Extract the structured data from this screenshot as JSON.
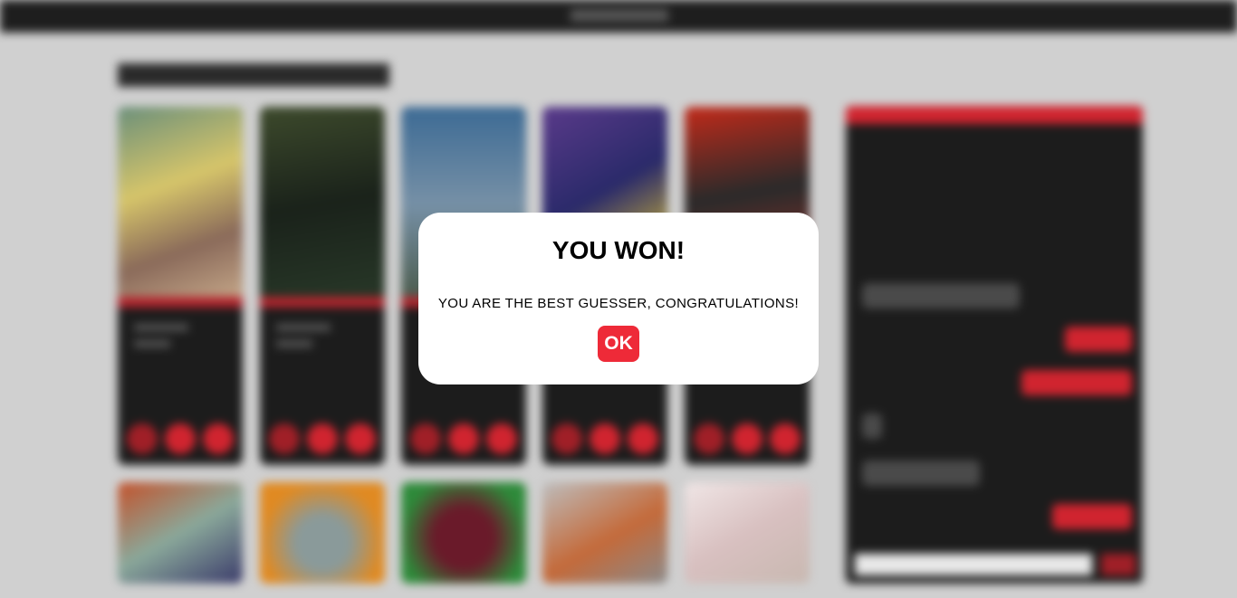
{
  "modal": {
    "title": "YOU WON!",
    "message": "YOU ARE THE BEST GUESSER, CONGRATULATIONS!",
    "ok_label": "OK"
  },
  "colors": {
    "accent": "#ee2a38",
    "topbar": "#1e1e1e",
    "card_bg": "#1c1c1c",
    "overlay_bg": "#d0d0d0"
  }
}
